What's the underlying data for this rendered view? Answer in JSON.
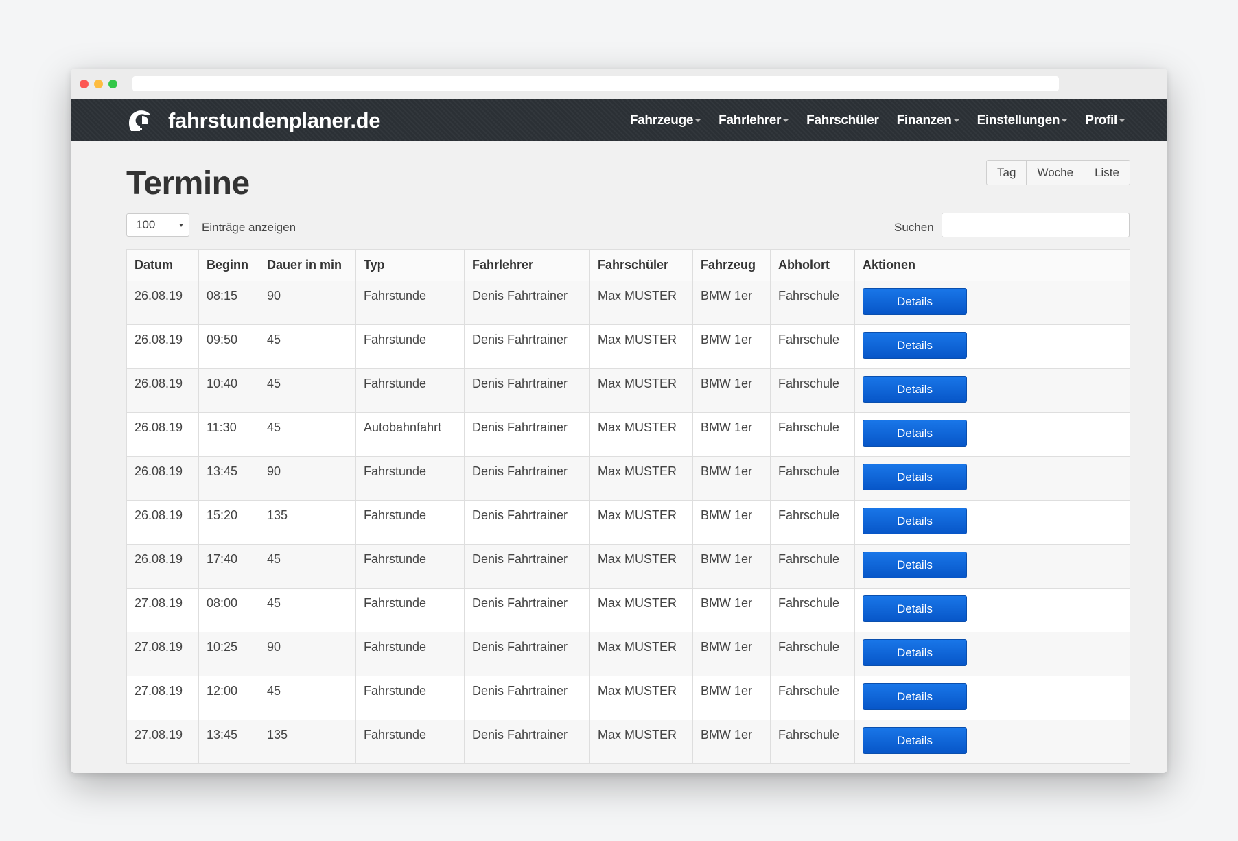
{
  "brand": {
    "name": "fahrstundenplaner.de",
    "logo_icon": "helmet-logo-icon"
  },
  "nav": [
    {
      "label": "Fahrzeuge",
      "dropdown": true
    },
    {
      "label": "Fahrlehrer",
      "dropdown": true
    },
    {
      "label": "Fahrschüler",
      "dropdown": false
    },
    {
      "label": "Finanzen",
      "dropdown": true
    },
    {
      "label": "Einstellungen",
      "dropdown": true
    },
    {
      "label": "Profil",
      "dropdown": true
    }
  ],
  "page": {
    "title": "Termine",
    "views": [
      "Tag",
      "Woche",
      "Liste"
    ],
    "length_value": "100",
    "length_label": "Einträge anzeigen",
    "search_label": "Suchen",
    "search_value": ""
  },
  "table": {
    "columns": [
      "Datum",
      "Beginn",
      "Dauer in min",
      "Typ",
      "Fahrlehrer",
      "Fahrschüler",
      "Fahrzeug",
      "Abholort",
      "Aktionen"
    ],
    "action_label": "Details",
    "rows": [
      [
        "26.08.19",
        "08:15",
        "90",
        "Fahrstunde",
        "Denis Fahrtrainer",
        "Max MUSTER",
        "BMW 1er",
        "Fahrschule"
      ],
      [
        "26.08.19",
        "09:50",
        "45",
        "Fahrstunde",
        "Denis Fahrtrainer",
        "Max MUSTER",
        "BMW 1er",
        "Fahrschule"
      ],
      [
        "26.08.19",
        "10:40",
        "45",
        "Fahrstunde",
        "Denis Fahrtrainer",
        "Max MUSTER",
        "BMW 1er",
        "Fahrschule"
      ],
      [
        "26.08.19",
        "11:30",
        "45",
        "Autobahnfahrt",
        "Denis Fahrtrainer",
        "Max MUSTER",
        "BMW 1er",
        "Fahrschule"
      ],
      [
        "26.08.19",
        "13:45",
        "90",
        "Fahrstunde",
        "Denis Fahrtrainer",
        "Max MUSTER",
        "BMW 1er",
        "Fahrschule"
      ],
      [
        "26.08.19",
        "15:20",
        "135",
        "Fahrstunde",
        "Denis Fahrtrainer",
        "Max MUSTER",
        "BMW 1er",
        "Fahrschule"
      ],
      [
        "26.08.19",
        "17:40",
        "45",
        "Fahrstunde",
        "Denis Fahrtrainer",
        "Max MUSTER",
        "BMW 1er",
        "Fahrschule"
      ],
      [
        "27.08.19",
        "08:00",
        "45",
        "Fahrstunde",
        "Denis Fahrtrainer",
        "Max MUSTER",
        "BMW 1er",
        "Fahrschule"
      ],
      [
        "27.08.19",
        "10:25",
        "90",
        "Fahrstunde",
        "Denis Fahrtrainer",
        "Max MUSTER",
        "BMW 1er",
        "Fahrschule"
      ],
      [
        "27.08.19",
        "12:00",
        "45",
        "Fahrstunde",
        "Denis Fahrtrainer",
        "Max MUSTER",
        "BMW 1er",
        "Fahrschule"
      ],
      [
        "27.08.19",
        "13:45",
        "135",
        "Fahrstunde",
        "Denis Fahrtrainer",
        "Max MUSTER",
        "BMW 1er",
        "Fahrschule"
      ]
    ]
  },
  "colors": {
    "navbar": "#2b3035",
    "primary_button": "#0a63d6"
  }
}
